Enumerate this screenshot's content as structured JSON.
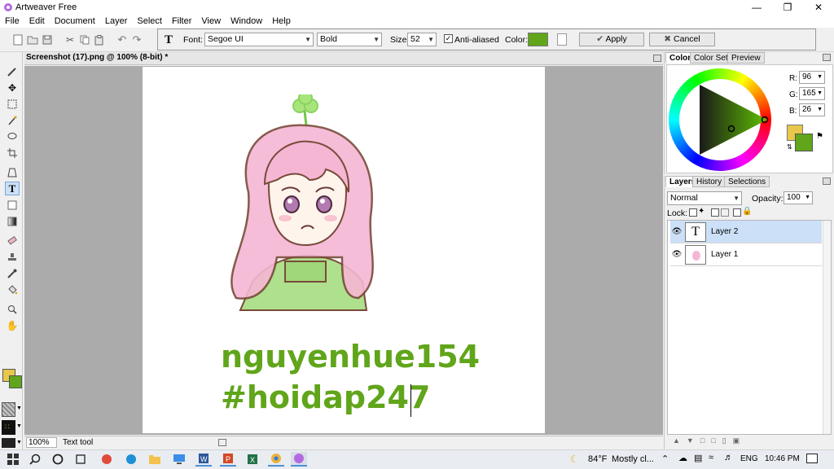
{
  "window": {
    "title": "Artweaver Free"
  },
  "menu": [
    "File",
    "Edit",
    "Document",
    "Layer",
    "Select",
    "Filter",
    "View",
    "Window",
    "Help"
  ],
  "options": {
    "font_label": "Font:",
    "font_value": "Segoe UI",
    "style_value": "Bold",
    "size_label": "Size:",
    "size_value": "52",
    "anti_aliased_label": "Anti-aliased",
    "color_label": "Color:",
    "apply_label": "Apply",
    "cancel_label": "Cancel"
  },
  "document": {
    "tab_title": "Screenshot (17).png @ 100% (8-bit) *",
    "text_line1": "nguyenhue154",
    "text_line2": "#hoidap247"
  },
  "status": {
    "zoom": "100%",
    "tool": "Text tool"
  },
  "color_panel": {
    "tabs": [
      "Color",
      "Color Set",
      "Preview"
    ],
    "r_label": "R:",
    "r_value": "96",
    "g_label": "G:",
    "g_value": "165",
    "b_label": "B:",
    "b_value": "26"
  },
  "layers_panel": {
    "tabs": [
      "Layers",
      "History",
      "Selections"
    ],
    "blend_mode": "Normal",
    "opacity_label": "Opacity:",
    "opacity_value": "100",
    "lock_label": "Lock:",
    "layers": [
      {
        "name": "Layer 2",
        "thumb": "T"
      },
      {
        "name": "Layer 1"
      }
    ]
  },
  "taskbar": {
    "temp": "84°F",
    "weather": "Mostly cl...",
    "lang": "ENG",
    "time": "10:46 PM"
  },
  "colors": {
    "foreground": "#60a51a",
    "secondary": "#e8c84a",
    "accent_selected": "#cce0f7"
  }
}
